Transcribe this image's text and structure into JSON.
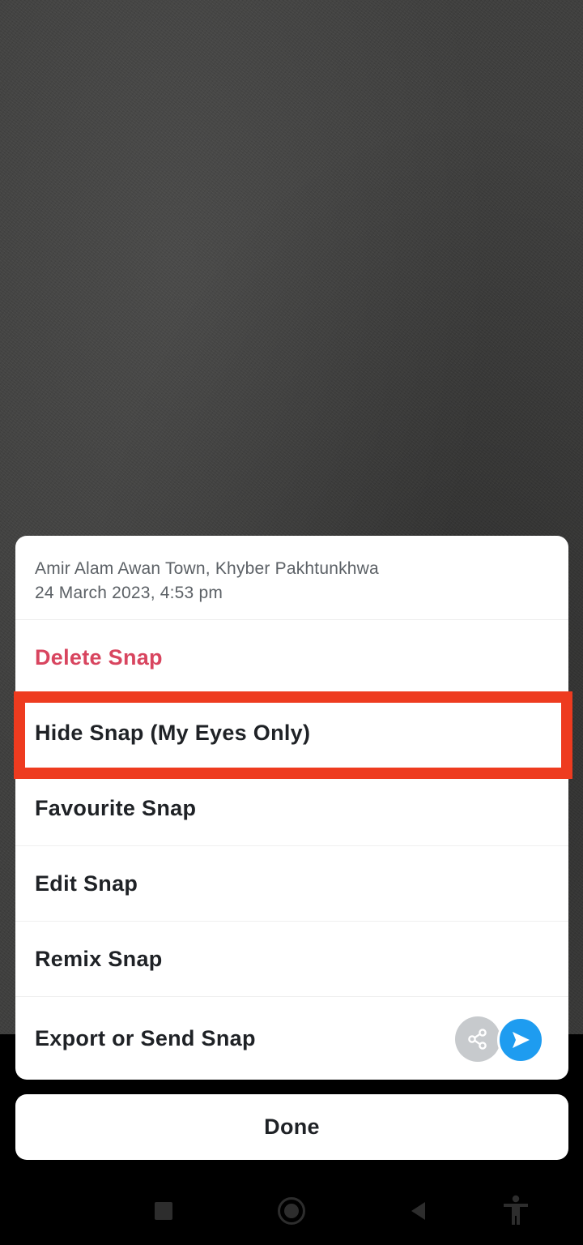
{
  "snap_info": {
    "location": "Amir Alam Awan Town, Khyber Pakhtunkhwa",
    "timestamp": "24 March 2023, 4:53 pm"
  },
  "menu": {
    "delete": "Delete Snap",
    "hide": "Hide Snap (My Eyes Only)",
    "favourite": "Favourite Snap",
    "edit": "Edit Snap",
    "remix": "Remix Snap",
    "export": "Export or Send Snap"
  },
  "done_label": "Done",
  "icons": {
    "share": "share-icon",
    "send": "send-icon",
    "nav_recents": "recents-icon",
    "nav_home": "home-icon",
    "nav_back": "back-icon",
    "nav_accessibility": "accessibility-icon"
  },
  "colors": {
    "delete_text": "#d8455f",
    "highlight": "#ee3b1f",
    "send_blue": "#1e9cf0"
  }
}
